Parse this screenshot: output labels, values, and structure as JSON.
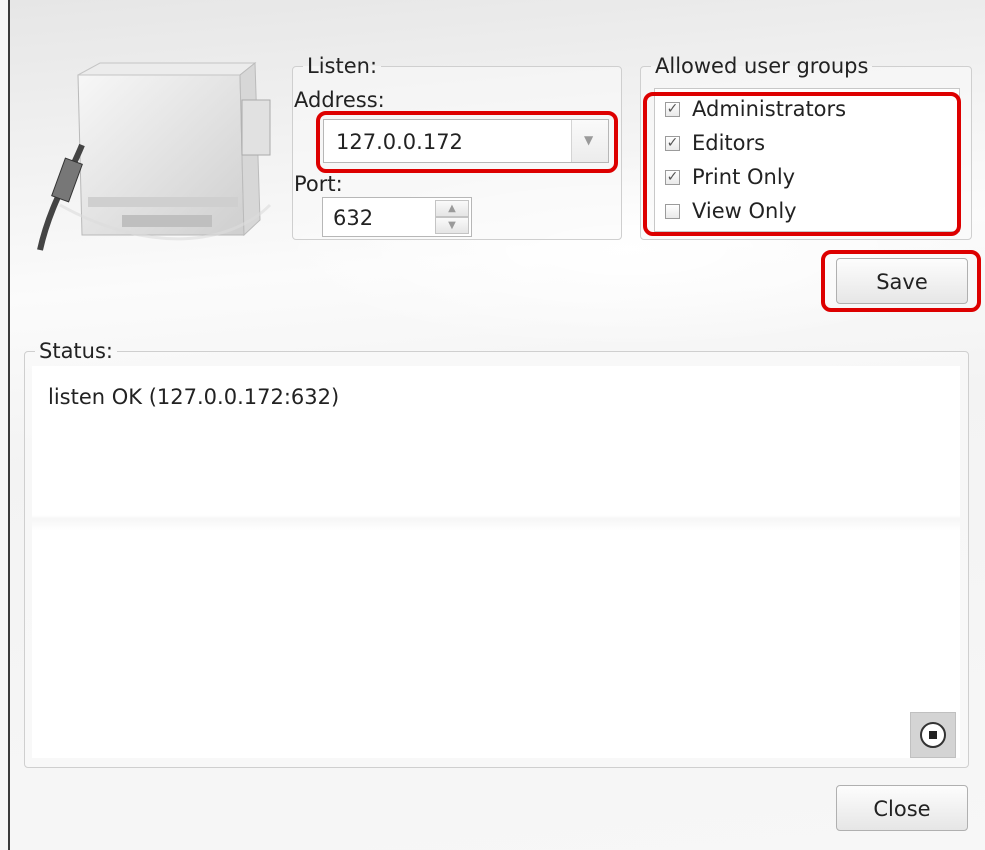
{
  "listen": {
    "legend": "Listen:",
    "address_label": "Address:",
    "address_value": "127.0.0.172",
    "port_label": "Port:",
    "port_value": "632"
  },
  "groups": {
    "legend": "Allowed user groups",
    "items": [
      {
        "label": "Administrators",
        "checked": true
      },
      {
        "label": "Editors",
        "checked": true
      },
      {
        "label": "Print Only",
        "checked": true
      },
      {
        "label": "View Only",
        "checked": false
      }
    ]
  },
  "buttons": {
    "save": "Save",
    "close": "Close"
  },
  "status": {
    "legend": "Status:",
    "text": "listen OK (127.0.0.172:632)"
  },
  "colors": {
    "highlight": "#dd0000"
  }
}
